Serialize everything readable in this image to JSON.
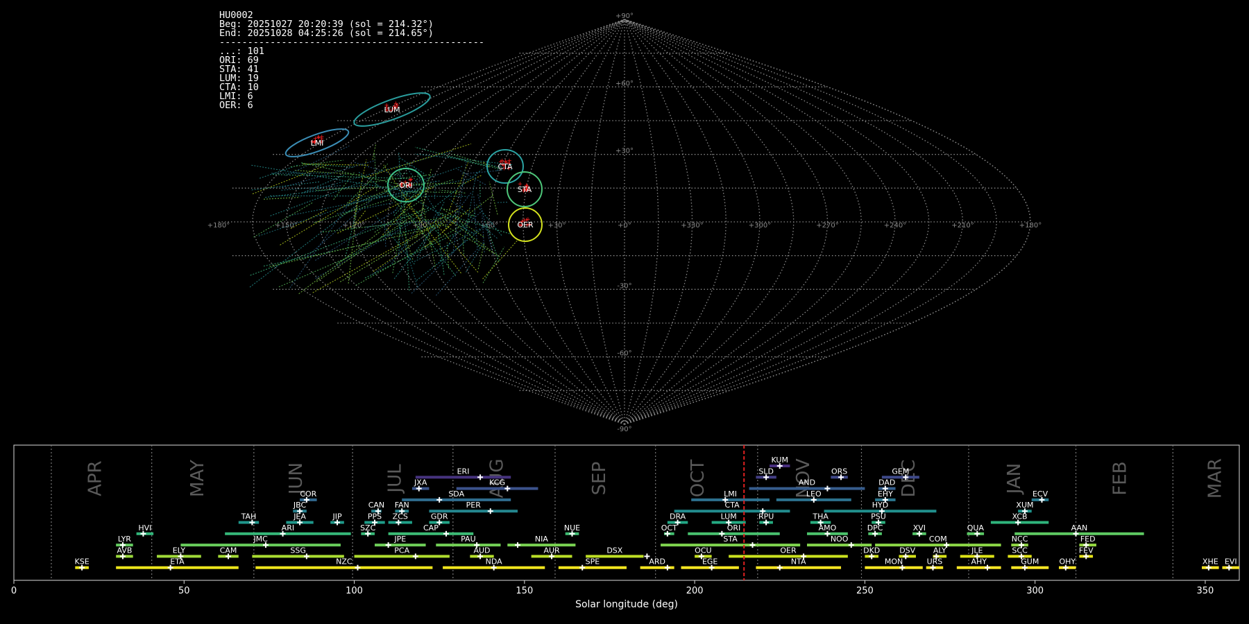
{
  "info": {
    "id": "HU0002",
    "beg": "Beg: 20251027 20:20:39 (sol = 214.32°)",
    "end": "End: 20251028 04:25:26 (sol = 214.65°)",
    "separator": "-----------------------------------------------",
    "counts": [
      "...: 101",
      "ORI: 69",
      "STA: 41",
      "LUM: 19",
      "CTA: 10",
      "LMI: 6",
      "OER: 6"
    ]
  },
  "chart_data": [
    {
      "type": "scatter",
      "projection": "sinusoidal sky map",
      "lon_ticks": [
        "+180°",
        "+150°",
        "+120°",
        "+90°",
        "+60°",
        "+30°",
        "+0°",
        "+330°",
        "+300°",
        "+270°",
        "+240°",
        "+210°",
        "+180°"
      ],
      "lat_ticks": [
        "+90°",
        "+60°",
        "+30°",
        "-30°",
        "-60°",
        "-90°"
      ],
      "showers": [
        {
          "code": "LUM",
          "ra": 112,
          "dec": 51,
          "color": "#2a9d9d"
        },
        {
          "code": "LMI",
          "ra": 160,
          "dec": 38,
          "color": "#3b8db5"
        },
        {
          "code": "CTA",
          "ra": 40,
          "dec": 19,
          "color": "#2ba3a3"
        },
        {
          "code": "ORI",
          "ra": 93,
          "dec": 15,
          "color": "#3ec28a"
        },
        {
          "code": "STA",
          "ra": 33,
          "dec": 12,
          "color": "#4ec77a"
        },
        {
          "code": "OER",
          "ra": 40,
          "dec": -1,
          "color": "#d4e21e"
        }
      ]
    },
    {
      "type": "bar",
      "xlabel": "Solar longitude (deg)",
      "xlim": [
        0,
        360
      ],
      "xticks": [
        0,
        50,
        100,
        150,
        200,
        250,
        300,
        350
      ],
      "current_sol": 214.5,
      "months": [
        {
          "label": "APR",
          "x": 24
        },
        {
          "label": "MAY",
          "x": 54
        },
        {
          "label": "JUN",
          "x": 83
        },
        {
          "label": "JUL",
          "x": 112
        },
        {
          "label": "AUG",
          "x": 142
        },
        {
          "label": "SEP",
          "x": 172
        },
        {
          "label": "OCT",
          "x": 201
        },
        {
          "label": "NOV",
          "x": 232
        },
        {
          "label": "DEC",
          "x": 263
        },
        {
          "label": "JAN",
          "x": 294
        },
        {
          "label": "FEB",
          "x": 325
        },
        {
          "label": "MAR",
          "x": 353
        }
      ],
      "month_dividers": [
        11,
        40.5,
        70.5,
        99.5,
        129,
        159,
        188.5,
        218.5,
        249,
        280.5,
        312,
        340.5
      ],
      "showers": [
        {
          "code": "KUM",
          "start": 222,
          "end": 228,
          "peak": 225,
          "row": 10,
          "color": "#482f7f"
        },
        {
          "code": "ERI",
          "start": 118,
          "end": 146,
          "peak": 137,
          "row": 9,
          "color": "#46337e"
        },
        {
          "code": "SLD",
          "start": 218,
          "end": 224,
          "peak": 221,
          "row": 9,
          "color": "#433e85"
        },
        {
          "code": "ORS",
          "start": 240,
          "end": 245,
          "peak": 243,
          "row": 9,
          "color": "#3f4889"
        },
        {
          "code": "GEM",
          "start": 255,
          "end": 266,
          "peak": 262,
          "row": 9,
          "color": "#3e4989"
        },
        {
          "code": "JXA",
          "start": 117,
          "end": 122,
          "peak": 119,
          "row": 8,
          "color": "#3a548c"
        },
        {
          "code": "KCG",
          "start": 130,
          "end": 154,
          "peak": 145,
          "row": 8,
          "color": "#3b528b"
        },
        {
          "code": "AND",
          "start": 216,
          "end": 250,
          "peak": 239,
          "row": 8,
          "color": "#365c8d"
        },
        {
          "code": "DAD",
          "start": 254,
          "end": 259,
          "peak": 256,
          "row": 8,
          "color": "#355f8d"
        },
        {
          "code": "COR",
          "start": 84,
          "end": 89,
          "peak": 86,
          "row": 7,
          "color": "#31688e"
        },
        {
          "code": "SDA",
          "start": 114,
          "end": 146,
          "peak": 125,
          "row": 7,
          "color": "#2f6c8e"
        },
        {
          "code": "LMI",
          "start": 199,
          "end": 222,
          "peak": 209,
          "row": 7,
          "color": "#2d708e"
        },
        {
          "code": "LEO",
          "start": 224,
          "end": 246,
          "peak": 235,
          "row": 7,
          "color": "#2c728e"
        },
        {
          "code": "EHY",
          "start": 253,
          "end": 259,
          "peak": 256,
          "row": 7,
          "color": "#2a768e"
        },
        {
          "code": "ECV",
          "start": 299,
          "end": 304,
          "peak": 302,
          "row": 7,
          "color": "#297a8e"
        },
        {
          "code": "JBC",
          "start": 82,
          "end": 86,
          "peak": 84,
          "row": 6,
          "color": "#277f8e"
        },
        {
          "code": "CAN",
          "start": 105,
          "end": 108,
          "peak": 107,
          "row": 6,
          "color": "#26828e"
        },
        {
          "code": "FAN",
          "start": 112,
          "end": 116,
          "peak": 114,
          "row": 6,
          "color": "#25848e"
        },
        {
          "code": "PER",
          "start": 122,
          "end": 148,
          "peak": 140,
          "row": 6,
          "color": "#24868e"
        },
        {
          "code": "CTA",
          "start": 194,
          "end": 228,
          "peak": 220,
          "row": 6,
          "color": "#228b8d"
        },
        {
          "code": "HYD",
          "start": 238,
          "end": 271,
          "peak": 255,
          "row": 6,
          "color": "#208f8c"
        },
        {
          "code": "XUM",
          "start": 295,
          "end": 299,
          "peak": 297,
          "row": 6,
          "color": "#1f938b"
        },
        {
          "code": "TAH",
          "start": 66,
          "end": 72,
          "peak": 70,
          "row": 5,
          "color": "#1f968b"
        },
        {
          "code": "JEA",
          "start": 80,
          "end": 88,
          "peak": 84,
          "row": 5,
          "color": "#1f988b"
        },
        {
          "code": "JIP",
          "start": 93,
          "end": 97,
          "peak": 95,
          "row": 5,
          "color": "#1f9a8a"
        },
        {
          "code": "PPS",
          "start": 103,
          "end": 109,
          "peak": 106,
          "row": 5,
          "color": "#1f9d89"
        },
        {
          "code": "ZCS",
          "start": 110,
          "end": 117,
          "peak": 113,
          "row": 5,
          "color": "#1fa088"
        },
        {
          "code": "GDR",
          "start": 122,
          "end": 128,
          "peak": 125,
          "row": 5,
          "color": "#20a386"
        },
        {
          "code": "DRA",
          "start": 192,
          "end": 198,
          "peak": 195,
          "row": 5,
          "color": "#22a785"
        },
        {
          "code": "LUM",
          "start": 205,
          "end": 215,
          "peak": 210,
          "row": 5,
          "color": "#24aa83"
        },
        {
          "code": "RPU",
          "start": 219,
          "end": 223,
          "peak": 221,
          "row": 5,
          "color": "#26ad81"
        },
        {
          "code": "THA",
          "start": 234,
          "end": 240,
          "peak": 237,
          "row": 5,
          "color": "#29af7f"
        },
        {
          "code": "PSU",
          "start": 252,
          "end": 256,
          "peak": 254,
          "row": 5,
          "color": "#2cb17e"
        },
        {
          "code": "XCB",
          "start": 287,
          "end": 304,
          "peak": 295,
          "row": 5,
          "color": "#2fb47c"
        },
        {
          "code": "HVI",
          "start": 36,
          "end": 41,
          "peak": 38,
          "row": 4,
          "color": "#32b67a"
        },
        {
          "code": "ARI",
          "start": 62,
          "end": 99,
          "peak": 79,
          "row": 4,
          "color": "#35b779"
        },
        {
          "code": "SZC",
          "start": 102,
          "end": 106,
          "peak": 104,
          "row": 4,
          "color": "#38b977"
        },
        {
          "code": "CAP",
          "start": 110,
          "end": 135,
          "peak": 127,
          "row": 4,
          "color": "#3cbb75"
        },
        {
          "code": "NUE",
          "start": 162,
          "end": 166,
          "peak": 164,
          "row": 4,
          "color": "#40bd72"
        },
        {
          "code": "OCT",
          "start": 191,
          "end": 194,
          "peak": 192,
          "row": 4,
          "color": "#44bf70"
        },
        {
          "code": "ORI",
          "start": 198,
          "end": 225,
          "peak": 208,
          "row": 4,
          "color": "#48c16e"
        },
        {
          "code": "AMO",
          "start": 233,
          "end": 245,
          "peak": 239,
          "row": 4,
          "color": "#4cc26c"
        },
        {
          "code": "DPC",
          "start": 251,
          "end": 255,
          "peak": 253,
          "row": 4,
          "color": "#50c46a"
        },
        {
          "code": "XVI",
          "start": 264,
          "end": 268,
          "peak": 266,
          "row": 4,
          "color": "#55c667"
        },
        {
          "code": "QUA",
          "start": 280,
          "end": 285,
          "peak": 283,
          "row": 4,
          "color": "#5ac864"
        },
        {
          "code": "AAN",
          "start": 294,
          "end": 332,
          "peak": 312,
          "row": 4,
          "color": "#5ec962"
        },
        {
          "code": "LYR",
          "start": 30,
          "end": 35,
          "peak": 32,
          "row": 3,
          "color": "#63cb5f"
        },
        {
          "code": "JMC",
          "start": 49,
          "end": 96,
          "peak": 74,
          "row": 3,
          "color": "#68cd5b"
        },
        {
          "code": "JPE",
          "start": 106,
          "end": 121,
          "peak": 110,
          "row": 3,
          "color": "#6ece58"
        },
        {
          "code": "PAU",
          "start": 124,
          "end": 143,
          "peak": 136,
          "row": 3,
          "color": "#73d056"
        },
        {
          "code": "NIA",
          "start": 145,
          "end": 165,
          "peak": 148,
          "row": 3,
          "color": "#79d151"
        },
        {
          "code": "STA",
          "start": 190,
          "end": 231,
          "peak": 217,
          "row": 3,
          "color": "#7fd34e"
        },
        {
          "code": "NOO",
          "start": 233,
          "end": 252,
          "peak": 246,
          "row": 3,
          "color": "#84d44b"
        },
        {
          "code": "COM",
          "start": 253,
          "end": 290,
          "peak": 274,
          "row": 3,
          "color": "#8bd646"
        },
        {
          "code": "NCC",
          "start": 293,
          "end": 298,
          "peak": 296,
          "row": 3,
          "color": "#90d743"
        },
        {
          "code": "FED",
          "start": 313,
          "end": 318,
          "peak": 315,
          "row": 3,
          "color": "#95d840"
        },
        {
          "code": "AVB",
          "start": 30,
          "end": 35,
          "peak": 32,
          "row": 2,
          "color": "#9bd93c"
        },
        {
          "code": "ELY",
          "start": 42,
          "end": 55,
          "peak": 49,
          "row": 2,
          "color": "#a0da39"
        },
        {
          "code": "CAM",
          "start": 60,
          "end": 66,
          "peak": 63,
          "row": 2,
          "color": "#a5db36"
        },
        {
          "code": "SSG",
          "start": 70,
          "end": 97,
          "peak": 86,
          "row": 2,
          "color": "#aadc32"
        },
        {
          "code": "PCA",
          "start": 100,
          "end": 128,
          "peak": 118,
          "row": 2,
          "color": "#b0dd2f"
        },
        {
          "code": "AUD",
          "start": 134,
          "end": 141,
          "peak": 137,
          "row": 2,
          "color": "#b5de2b"
        },
        {
          "code": "AUR",
          "start": 152,
          "end": 164,
          "peak": 158,
          "row": 2,
          "color": "#bade28"
        },
        {
          "code": "DSX",
          "start": 168,
          "end": 185,
          "peak": 186,
          "row": 2,
          "color": "#bfdf25"
        },
        {
          "code": "OCU",
          "start": 200,
          "end": 205,
          "peak": 202,
          "row": 2,
          "color": "#c5e021"
        },
        {
          "code": "OER",
          "start": 210,
          "end": 245,
          "peak": 232,
          "row": 2,
          "color": "#cae11f"
        },
        {
          "code": "DKD",
          "start": 250,
          "end": 254,
          "peak": 252,
          "row": 2,
          "color": "#d0e11c"
        },
        {
          "code": "DSV",
          "start": 260,
          "end": 265,
          "peak": 262,
          "row": 2,
          "color": "#d5e21a"
        },
        {
          "code": "ALY",
          "start": 270,
          "end": 274,
          "peak": 271,
          "row": 2,
          "color": "#d8e219"
        },
        {
          "code": "JLE",
          "start": 278,
          "end": 288,
          "peak": 283,
          "row": 2,
          "color": "#dde318"
        },
        {
          "code": "SCC",
          "start": 292,
          "end": 299,
          "peak": 296,
          "row": 2,
          "color": "#e2e418"
        },
        {
          "code": "FEV",
          "start": 313,
          "end": 317,
          "peak": 315,
          "row": 2,
          "color": "#e7e419"
        },
        {
          "code": "KSE",
          "start": 18,
          "end": 22,
          "peak": 20,
          "row": 1,
          "color": "#eae51a"
        },
        {
          "code": "ETA",
          "start": 30,
          "end": 66,
          "peak": 46,
          "row": 1,
          "color": "#ece51b"
        },
        {
          "code": "NZC",
          "start": 71,
          "end": 123,
          "peak": 101,
          "row": 1,
          "color": "#efe51c"
        },
        {
          "code": "NDA",
          "start": 126,
          "end": 156,
          "peak": 141,
          "row": 1,
          "color": "#f1e51d"
        },
        {
          "code": "SPE",
          "start": 160,
          "end": 180,
          "peak": 167,
          "row": 1,
          "color": "#f4e61e"
        },
        {
          "code": "ARD",
          "start": 184,
          "end": 194,
          "peak": 192,
          "row": 1,
          "color": "#f6e620"
        },
        {
          "code": "EGE",
          "start": 196,
          "end": 213,
          "peak": 205,
          "row": 1,
          "color": "#f8e621"
        },
        {
          "code": "NTA",
          "start": 218,
          "end": 243,
          "peak": 225,
          "row": 1,
          "color": "#fae622"
        },
        {
          "code": "MON",
          "start": 250,
          "end": 267,
          "peak": 261,
          "row": 1,
          "color": "#fbe723"
        },
        {
          "code": "URS",
          "start": 268,
          "end": 273,
          "peak": 270,
          "row": 1,
          "color": "#fce724"
        },
        {
          "code": "AHY",
          "start": 277,
          "end": 290,
          "peak": 286,
          "row": 1,
          "color": "#fde725"
        },
        {
          "code": "GUM",
          "start": 293,
          "end": 304,
          "peak": 297,
          "row": 1,
          "color": "#fde725"
        },
        {
          "code": "OHY",
          "start": 307,
          "end": 312,
          "peak": 309,
          "row": 1,
          "color": "#fde725"
        },
        {
          "code": "XHE",
          "start": 349,
          "end": 354,
          "peak": 351,
          "row": 1,
          "color": "#fde725"
        },
        {
          "code": "EVI",
          "start": 355,
          "end": 360,
          "peak": 357,
          "row": 1,
          "color": "#fde725"
        }
      ]
    }
  ]
}
